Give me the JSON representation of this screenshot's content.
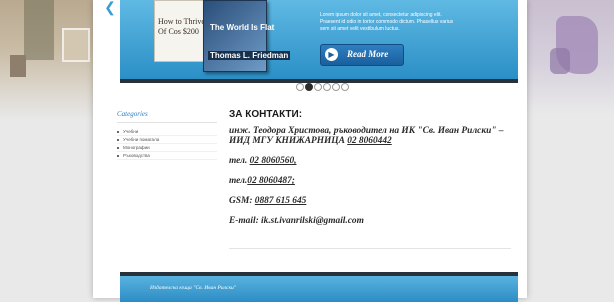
{
  "slider": {
    "book1_line1": "How to Thrive",
    "book1_line2": "Of Cos $200",
    "book1_line3": "",
    "book2_title": "The World Is Flat",
    "book2_author": "Thomas L. Friedman",
    "text": "Lorem ipsum dolor sit amet, consectetur adipiscing elit. Praesent id odio in tortor commodo dictum. Phasellus varius sem sit amet velit vestibulum luctus.",
    "read_more_label": "Read More",
    "dots_count": 6,
    "active_dot": 2
  },
  "sidebar": {
    "title": "Categories",
    "items": [
      {
        "label": "Учебни"
      },
      {
        "label": "Учебни помагала"
      },
      {
        "label": "Монографии"
      },
      {
        "label": "Ръководства"
      }
    ]
  },
  "content": {
    "title": "ЗА КОНТАКТИ:",
    "person": "инж. Теодора Христова, ръководител на ИК \"Св. Иван Рилски\" – ИИД МГУ КНИЖАРНИЦА",
    "person_phone": "02 8060442",
    "phone1_label": "тел.",
    "phone1": "02 8060560,",
    "phone2_label": "тел.",
    "phone2": "02 8060487;",
    "gsm_label": "GSM:",
    "gsm": "0887 615 645",
    "email_label": "E-mail:",
    "email": "ik.st.ivanrilski@gmail.com"
  },
  "footer": {
    "text": "Издателска къща \"Св. Иван Рилски\""
  },
  "colors": {
    "accent": "#2b8fc6",
    "dark_strip": "#263139",
    "link": "#2a7ec1"
  }
}
